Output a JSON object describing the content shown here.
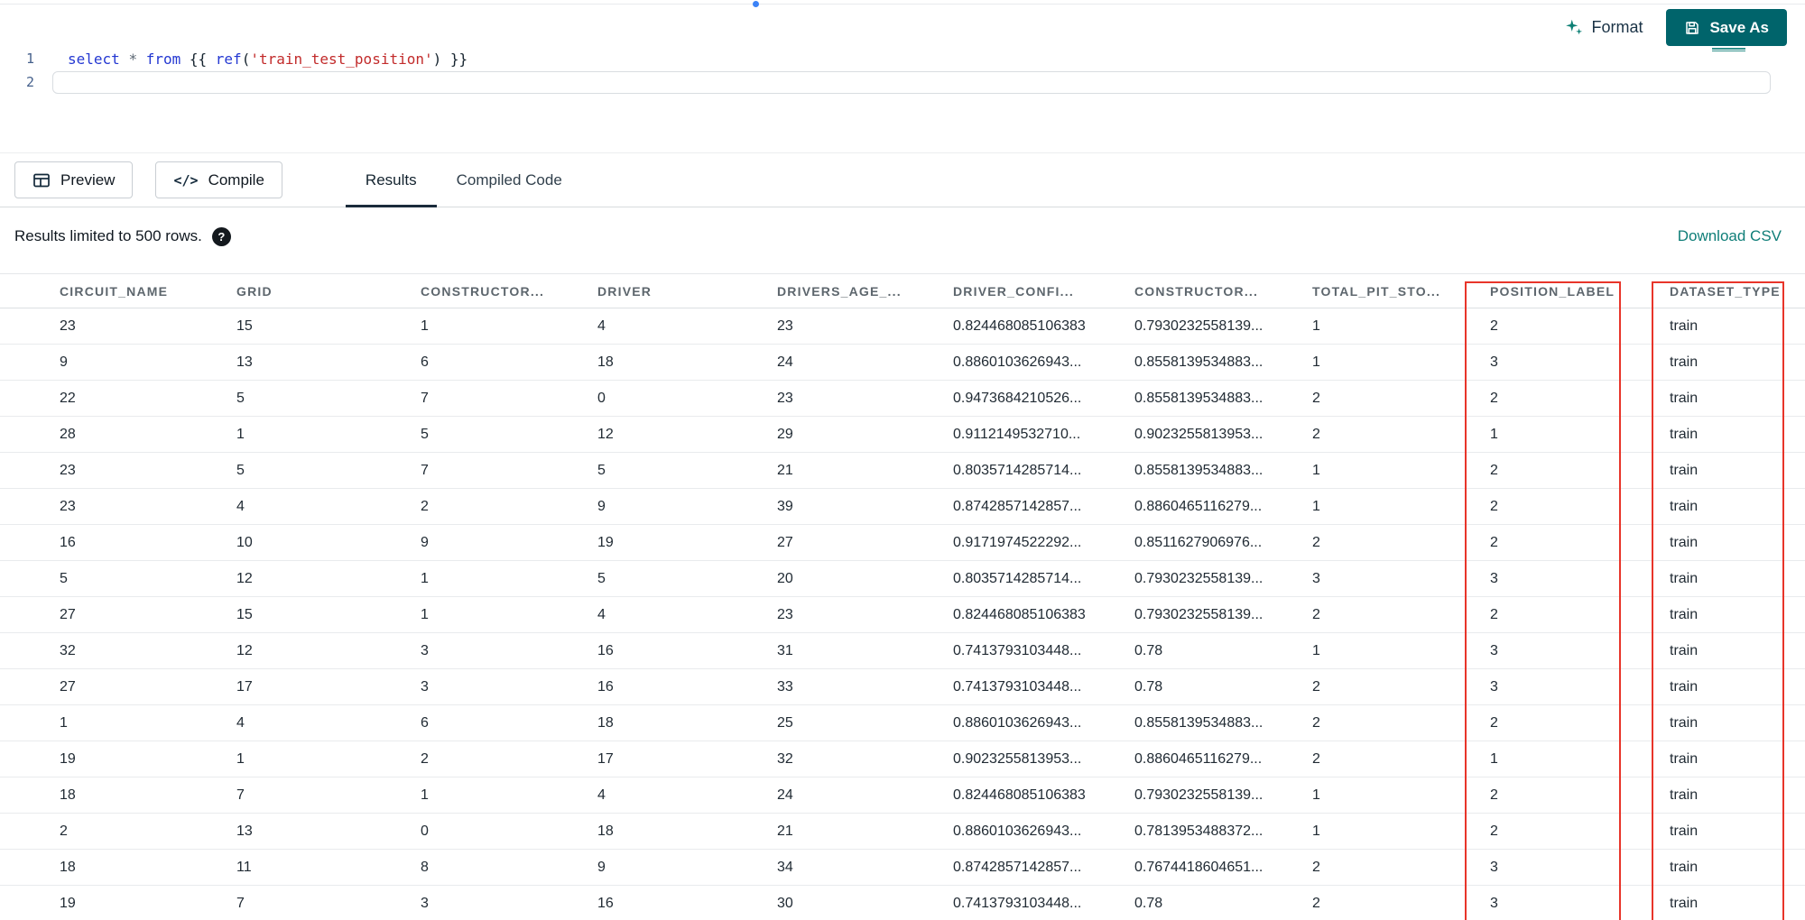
{
  "toolbar": {
    "format_label": "Format",
    "save_as_label": "Save As"
  },
  "editor": {
    "line_numbers": [
      "1",
      "2"
    ],
    "code_tokens": [
      {
        "text": "select",
        "type": "keyword"
      },
      {
        "text": " ",
        "type": "plain"
      },
      {
        "text": "*",
        "type": "operator"
      },
      {
        "text": " ",
        "type": "plain"
      },
      {
        "text": "from",
        "type": "keyword"
      },
      {
        "text": " {{ ",
        "type": "plain"
      },
      {
        "text": "ref",
        "type": "function"
      },
      {
        "text": "(",
        "type": "plain"
      },
      {
        "text": "'train_test_position'",
        "type": "string"
      },
      {
        "text": ")",
        "type": "plain"
      },
      {
        "text": " }}",
        "type": "plain"
      }
    ]
  },
  "controls": {
    "preview_label": "Preview",
    "compile_label": "Compile",
    "compile_glyph": "</>"
  },
  "tabs": [
    {
      "label": "Results",
      "active": true
    },
    {
      "label": "Compiled Code",
      "active": false
    }
  ],
  "results_meta": {
    "limit_note": "Results limited to 500 rows.",
    "help_glyph": "?",
    "download_label": "Download CSV"
  },
  "table": {
    "columns": [
      "CIRCUIT_NAME",
      "GRID",
      "CONSTRUCTOR...",
      "DRIVER",
      "DRIVERS_AGE_...",
      "DRIVER_CONFI...",
      "CONSTRUCTOR...",
      "TOTAL_PIT_STO...",
      "POSITION_LABEL",
      "DATASET_TYPE"
    ],
    "highlighted_columns": [
      "POSITION_LABEL",
      "DATASET_TYPE"
    ],
    "rows": [
      [
        "23",
        "15",
        "1",
        "4",
        "23",
        "0.824468085106383",
        "0.7930232558139...",
        "1",
        "2",
        "train"
      ],
      [
        "9",
        "13",
        "6",
        "18",
        "24",
        "0.8860103626943...",
        "0.8558139534883...",
        "1",
        "3",
        "train"
      ],
      [
        "22",
        "5",
        "7",
        "0",
        "23",
        "0.9473684210526...",
        "0.8558139534883...",
        "2",
        "2",
        "train"
      ],
      [
        "28",
        "1",
        "5",
        "12",
        "29",
        "0.9112149532710...",
        "0.9023255813953...",
        "2",
        "1",
        "train"
      ],
      [
        "23",
        "5",
        "7",
        "5",
        "21",
        "0.8035714285714...",
        "0.8558139534883...",
        "1",
        "2",
        "train"
      ],
      [
        "23",
        "4",
        "2",
        "9",
        "39",
        "0.8742857142857...",
        "0.8860465116279...",
        "1",
        "2",
        "train"
      ],
      [
        "16",
        "10",
        "9",
        "19",
        "27",
        "0.9171974522292...",
        "0.8511627906976...",
        "2",
        "2",
        "train"
      ],
      [
        "5",
        "12",
        "1",
        "5",
        "20",
        "0.8035714285714...",
        "0.7930232558139...",
        "3",
        "3",
        "train"
      ],
      [
        "27",
        "15",
        "1",
        "4",
        "23",
        "0.824468085106383",
        "0.7930232558139...",
        "2",
        "2",
        "train"
      ],
      [
        "32",
        "12",
        "3",
        "16",
        "31",
        "0.7413793103448...",
        "0.78",
        "1",
        "3",
        "train"
      ],
      [
        "27",
        "17",
        "3",
        "16",
        "33",
        "0.7413793103448...",
        "0.78",
        "2",
        "3",
        "train"
      ],
      [
        "1",
        "4",
        "6",
        "18",
        "25",
        "0.8860103626943...",
        "0.8558139534883...",
        "2",
        "2",
        "train"
      ],
      [
        "19",
        "1",
        "2",
        "17",
        "32",
        "0.9023255813953...",
        "0.8860465116279...",
        "2",
        "1",
        "train"
      ],
      [
        "18",
        "7",
        "1",
        "4",
        "24",
        "0.824468085106383",
        "0.7930232558139...",
        "1",
        "2",
        "train"
      ],
      [
        "2",
        "13",
        "0",
        "18",
        "21",
        "0.8860103626943...",
        "0.7813953488372...",
        "1",
        "2",
        "train"
      ],
      [
        "18",
        "11",
        "8",
        "9",
        "34",
        "0.8742857142857...",
        "0.7674418604651...",
        "2",
        "3",
        "train"
      ],
      [
        "19",
        "7",
        "3",
        "16",
        "30",
        "0.7413793103448...",
        "0.78",
        "2",
        "3",
        "train"
      ]
    ]
  },
  "colors": {
    "primary_button": "#00646b",
    "link": "#0f7e78",
    "highlight_border": "#e8352a",
    "code_keyword": "#2438d2",
    "code_string": "#c22b2b",
    "active_tab_underline": "#1a2b3b"
  }
}
